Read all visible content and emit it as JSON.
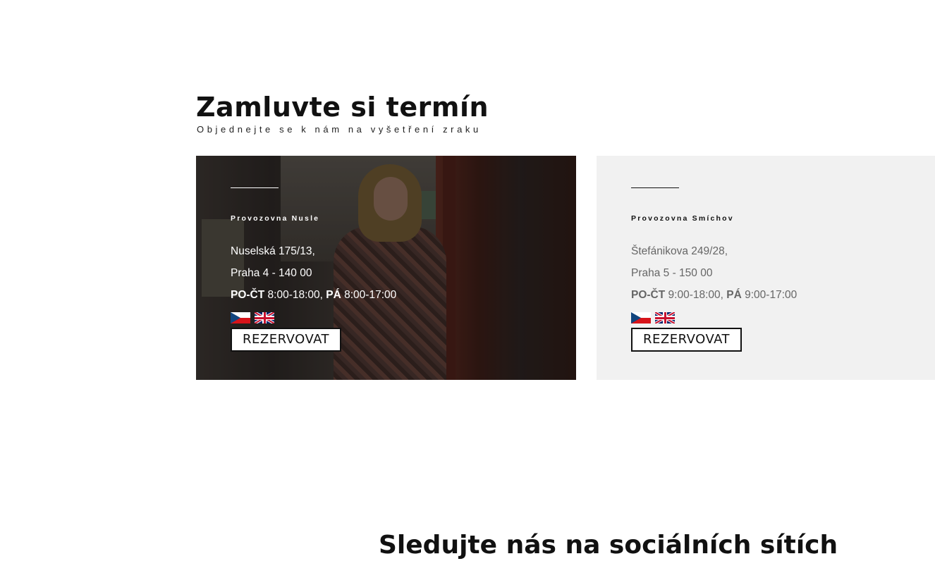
{
  "section": {
    "title": "Zamluvte si termín",
    "subtitle": "Objednejte se k nám na vyšetření zraku"
  },
  "branches": [
    {
      "name": "Provozovna Nusle",
      "street": "Nuselská 175/13,",
      "city": "Praha 4 - 140 00",
      "hours_label_1": "PO-ČT",
      "hours_1": " 8:00-18:00, ",
      "hours_label_2": "PÁ",
      "hours_2": " 8:00-17:00",
      "languages": [
        "czech-flag-icon",
        "uk-flag-icon"
      ],
      "button": "REZERVOVAT"
    },
    {
      "name": "Provozovna Smíchov",
      "street": "Štefánikova 249/28,",
      "city": "Praha 5 - 150 00",
      "hours_label_1": "PO-ČT",
      "hours_1": " 9:00-18:00, ",
      "hours_label_2": "PÁ",
      "hours_2": " 9:00-17:00",
      "languages": [
        "czech-flag-icon",
        "uk-flag-icon"
      ],
      "button": "REZERVOVAT"
    }
  ],
  "social": {
    "title": "Sledujte nás na sociálních sítích"
  },
  "colors": {
    "card_light_bg": "#f1f1f1",
    "text_dark": "#111111",
    "text_muted": "#666666"
  }
}
